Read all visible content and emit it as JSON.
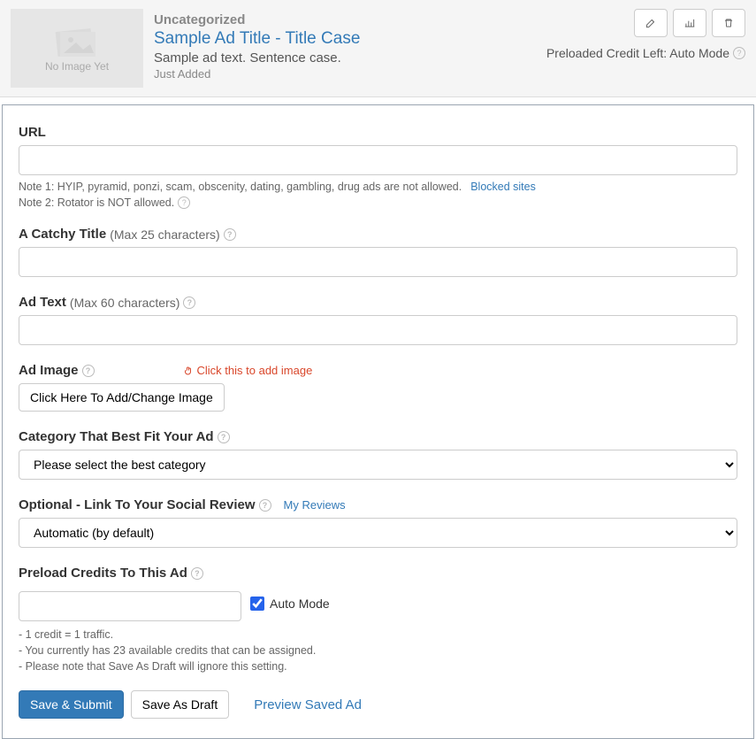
{
  "header": {
    "image_placeholder_text": "No Image Yet",
    "category": "Uncategorized",
    "title": "Sample Ad Title - Title Case",
    "text": "Sample ad text. Sentence case.",
    "added": "Just Added",
    "credit_line": "Preloaded Credit Left: Auto Mode"
  },
  "url": {
    "label": "URL",
    "value": "",
    "note1": "Note 1: HYIP, pyramid, ponzi, scam, obscenity, dating, gambling, drug ads are not allowed.",
    "blocked_link": "Blocked sites",
    "note2": "Note 2: Rotator is NOT allowed."
  },
  "title_field": {
    "label": "A Catchy Title",
    "hint": "(Max 25 characters)",
    "value": ""
  },
  "adtext": {
    "label": "Ad Text",
    "hint": "(Max 60 characters)",
    "value": ""
  },
  "adimage": {
    "label": "Ad Image",
    "red_hint": "Click this to add image",
    "button": "Click Here To Add/Change Image"
  },
  "category_field": {
    "label": "Category That Best Fit Your Ad",
    "selected": "Please select the best category"
  },
  "social": {
    "label": "Optional - Link To Your Social Review",
    "link": "My Reviews",
    "selected": "Automatic (by default)"
  },
  "preload": {
    "label": "Preload Credits To This Ad",
    "value": "",
    "checkbox_label": "Auto Mode",
    "note1": "- 1 credit = 1 traffic.",
    "note2": "- You currently has 23 available credits that can be assigned.",
    "note3": "- Please note that Save As Draft will ignore this setting."
  },
  "actions": {
    "save_submit": "Save & Submit",
    "save_draft": "Save As Draft",
    "preview": "Preview Saved Ad"
  }
}
